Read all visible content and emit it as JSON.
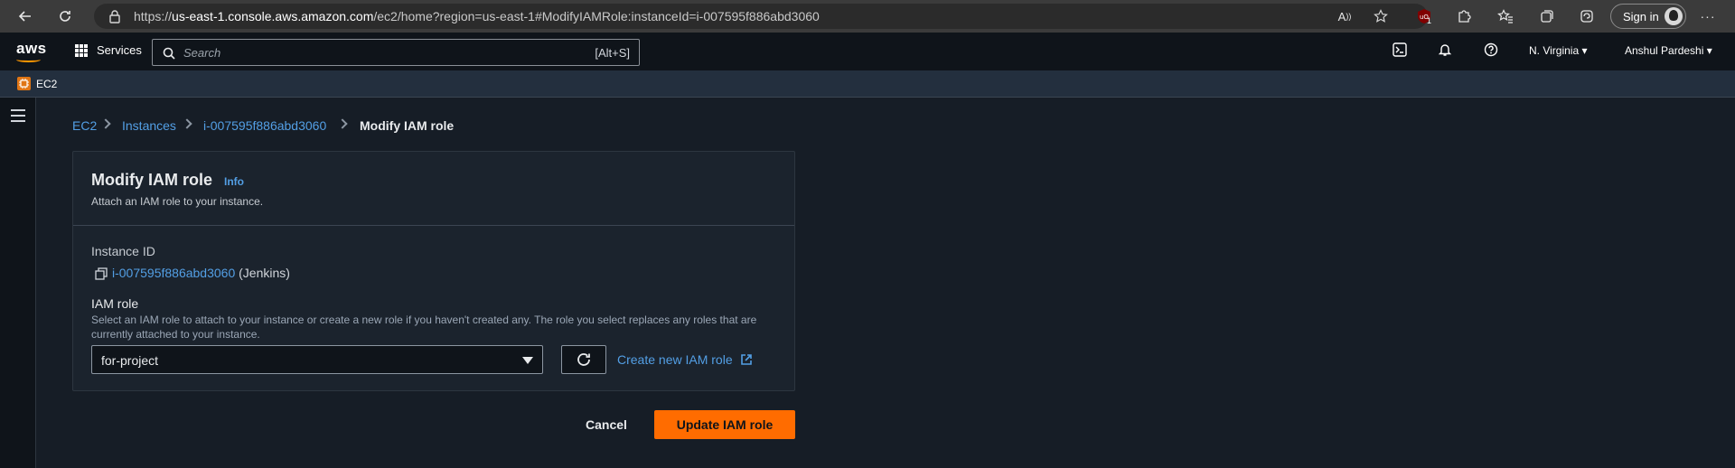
{
  "browser": {
    "url_prefix": "https://",
    "url_host": "us-east-1.console.aws.amazon.com",
    "url_path": "/ec2/home?region=us-east-1#ModifyIAMRole:instanceId=i-007595f886abd3060",
    "extension_badge": "1",
    "signin_label": "Sign in",
    "menu_label": "···"
  },
  "aws_nav": {
    "logo": "aws",
    "services_label": "Services",
    "search_placeholder": "Search",
    "search_shortcut": "[Alt+S]",
    "region": "N. Virginia ▾",
    "account": "Anshul Pardeshi ▾"
  },
  "favorites": {
    "ec2_label": "EC2"
  },
  "breadcrumb": {
    "ec2": "EC2",
    "instances": "Instances",
    "instance_id": "i-007595f886abd3060",
    "current": "Modify IAM role"
  },
  "panel": {
    "title": "Modify IAM role",
    "info": "Info",
    "subtitle": "Attach an IAM role to your instance.",
    "instance_id_label": "Instance ID",
    "instance_id_value": "i-007595f886abd3060",
    "instance_name": "(Jenkins)",
    "iam_role_label": "IAM role",
    "iam_role_description": "Select an IAM role to attach to your instance or create a new role if you haven't created any. The role you select replaces any roles that are currently attached to your instance.",
    "iam_role_selected": "for-project",
    "create_role_link": "Create new IAM role"
  },
  "actions": {
    "cancel": "Cancel",
    "update": "Update IAM role"
  },
  "colors": {
    "primary_button": "#ff6c00",
    "link": "#539fe5",
    "background": "#161d26",
    "panel": "#1b232d"
  }
}
